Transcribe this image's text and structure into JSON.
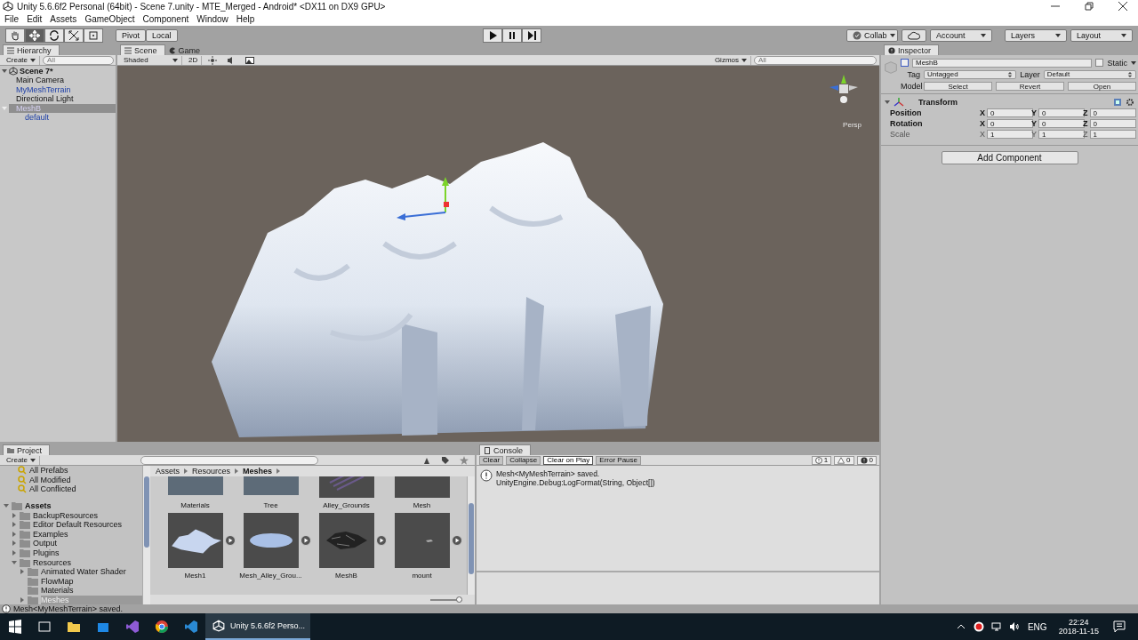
{
  "window": {
    "title": "Unity 5.6.6f2 Personal (64bit) - Scene 7.unity - MTE_Merged - Android* <DX11 on DX9 GPU>"
  },
  "menu": [
    "File",
    "Edit",
    "Assets",
    "GameObject",
    "Component",
    "Window",
    "Help"
  ],
  "toolbar": {
    "tools": [
      {
        "kind": "hand",
        "selected": false
      },
      {
        "kind": "move",
        "selected": true
      },
      {
        "kind": "rotate",
        "selected": false
      },
      {
        "kind": "scale",
        "selected": false
      },
      {
        "kind": "rect",
        "selected": false
      }
    ],
    "pivot": "Pivot",
    "local": "Local",
    "collab": "Collab",
    "account": "Account",
    "layers": "Layers",
    "layout": "Layout"
  },
  "hierarchy": {
    "tab": "Hierarchy",
    "create": "Create",
    "search_placeholder": "All",
    "scene": "Scene 7*",
    "items": [
      {
        "label": "Main Camera",
        "prefab": false,
        "selected": false
      },
      {
        "label": "MyMeshTerrain",
        "prefab": true,
        "selected": false
      },
      {
        "label": "Directional Light",
        "prefab": false,
        "selected": false
      },
      {
        "label": "MeshB",
        "prefab": true,
        "selected": true,
        "expanded": true,
        "children": [
          {
            "label": "default",
            "prefab": true,
            "selected": false
          }
        ]
      }
    ]
  },
  "scene": {
    "tabs": [
      {
        "label": "Scene",
        "kind": "scene",
        "selected": true
      },
      {
        "label": "Game",
        "kind": "game",
        "selected": false
      }
    ],
    "shading": "Shaded",
    "mode_2d": "2D",
    "gizmos": "Gizmos",
    "search_placeholder": "All",
    "projection": "Persp"
  },
  "inspector": {
    "tab": "Inspector",
    "name": "MeshB",
    "active": false,
    "static_label": "Static",
    "static": false,
    "tag_label": "Tag",
    "tag": "Untagged",
    "layer_label": "Layer",
    "layer": "Default",
    "model_label": "Model",
    "model_buttons": [
      "Select",
      "Revert",
      "Open"
    ],
    "transform": {
      "title": "Transform",
      "rows": [
        {
          "label": "Position",
          "overridden": true,
          "values": [
            {
              "axis": "X",
              "value": "0"
            },
            {
              "axis": "Y",
              "value": "0"
            },
            {
              "axis": "Z",
              "value": "0"
            }
          ]
        },
        {
          "label": "Rotation",
          "overridden": true,
          "values": [
            {
              "axis": "X",
              "value": "0"
            },
            {
              "axis": "Y",
              "value": "0"
            },
            {
              "axis": "Z",
              "value": "0"
            }
          ]
        },
        {
          "label": "Scale",
          "overridden": false,
          "values": [
            {
              "axis": "X",
              "value": "1"
            },
            {
              "axis": "Y",
              "value": "1"
            },
            {
              "axis": "Z",
              "value": "1"
            }
          ]
        }
      ]
    },
    "add_component": "Add Component"
  },
  "project": {
    "tab": "Project",
    "create": "Create",
    "favorites": [
      "All Prefabs",
      "All Modified",
      "All Conflicted"
    ],
    "tree": [
      {
        "label": "Assets",
        "expanded": true,
        "selected": false,
        "children": [
          {
            "label": "BackupResources",
            "expanded": false,
            "selected": false
          },
          {
            "label": "Editor Default Resources",
            "expanded": false,
            "selected": false
          },
          {
            "label": "Examples",
            "expanded": false,
            "selected": false
          },
          {
            "label": "Output",
            "expanded": false,
            "selected": false
          },
          {
            "label": "Plugins",
            "expanded": false,
            "selected": false
          },
          {
            "label": "Resources",
            "expanded": true,
            "selected": false,
            "children": [
              {
                "label": "Animated Water Shader",
                "expanded": false,
                "selected": false
              },
              {
                "label": "FlowMap",
                "selected": false
              },
              {
                "label": "Materials",
                "selected": false
              },
              {
                "label": "Meshes",
                "expanded": false,
                "selected": true
              }
            ]
          }
        ]
      }
    ],
    "breadcrumb": [
      "Assets",
      "Resources",
      "Meshes"
    ],
    "assets": [
      {
        "label": "Materials",
        "kind": "folder"
      },
      {
        "label": "Tree",
        "kind": "folder"
      },
      {
        "label": "Alley_Grounds",
        "kind": "mesh-stripes"
      },
      {
        "label": "Mesh",
        "kind": "mesh-empty"
      },
      {
        "label": "Mesh1",
        "kind": "mesh-terrain"
      },
      {
        "label": "Mesh_Alley_Grou...",
        "kind": "mesh-flat"
      },
      {
        "label": "MeshB",
        "kind": "mesh-dark"
      },
      {
        "label": "mount",
        "kind": "mesh-small"
      }
    ],
    "zoom_slider": {
      "level": 0.9
    }
  },
  "console": {
    "tab": "Console",
    "buttons": [
      {
        "label": "Clear"
      },
      {
        "label": "Collapse",
        "on": false
      },
      {
        "label": "Clear on Play",
        "on": true
      },
      {
        "label": "Error Pause",
        "on": false
      }
    ],
    "counts": [
      {
        "kind": "info",
        "count": "1"
      },
      {
        "kind": "warning",
        "count": "0"
      },
      {
        "kind": "error",
        "count": "0"
      }
    ],
    "messages": [
      {
        "kind": "info",
        "lines": [
          "Mesh<MyMeshTerrain> saved.",
          "UnityEngine.Debug:LogFormat(String, Object[])"
        ]
      }
    ]
  },
  "status_bar": {
    "message": "Mesh<MyMeshTerrain> saved."
  },
  "taskbar": {
    "apps": [
      {
        "kind": "explorer"
      },
      {
        "kind": "store"
      },
      {
        "kind": "visual-studio"
      },
      {
        "kind": "chrome"
      },
      {
        "kind": "vscode"
      }
    ],
    "task": "Unity 5.6.6f2 Perso...",
    "language": "ENG",
    "time": "22:24",
    "date": "2018-11-15"
  }
}
